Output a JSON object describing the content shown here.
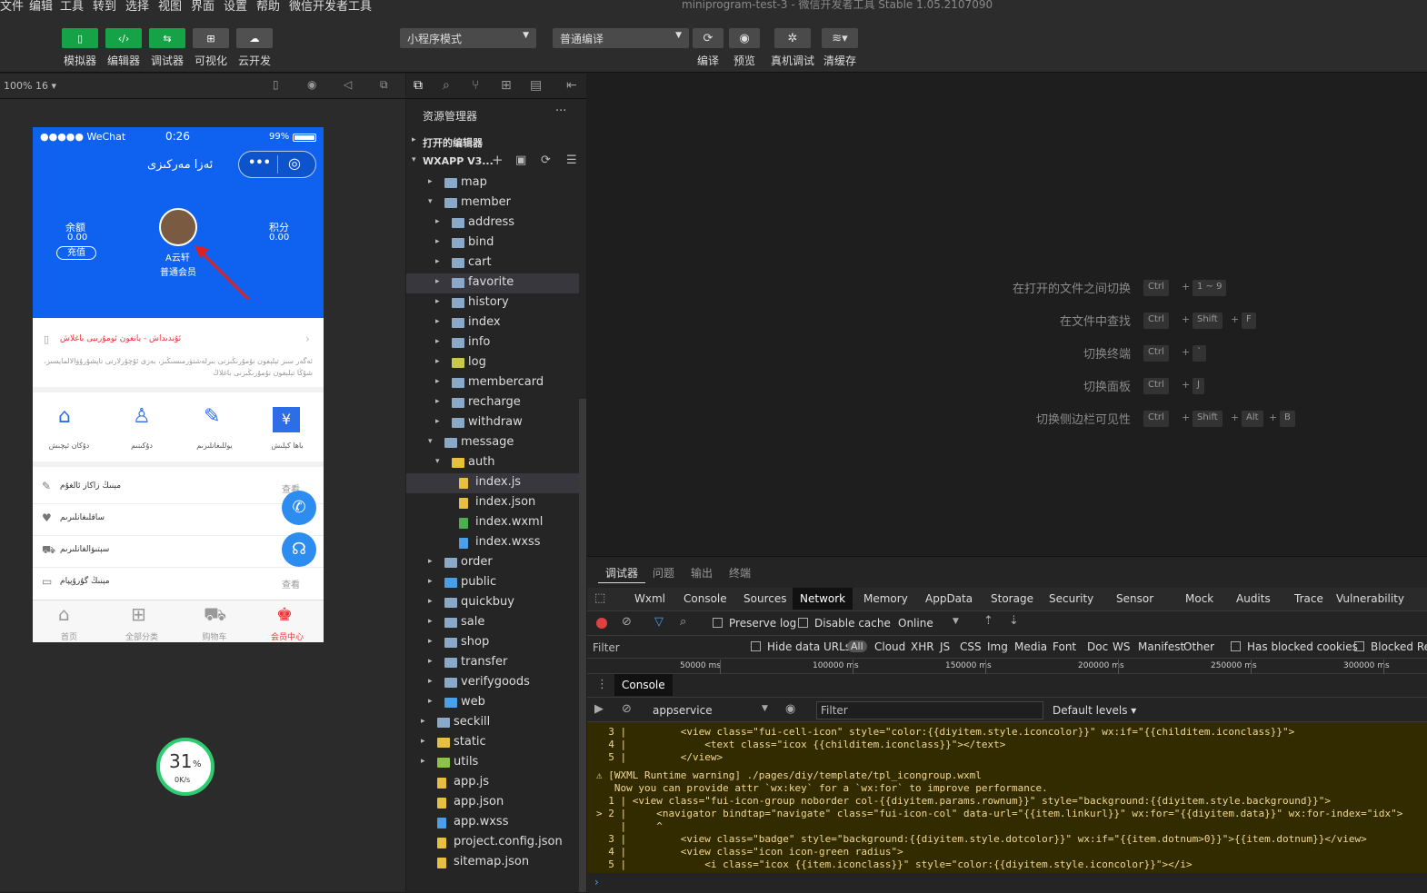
{
  "menu": {
    "items": [
      "文件",
      "编辑",
      "工具",
      "转到",
      "选择",
      "视图",
      "界面",
      "设置",
      "帮助",
      "微信开发者工具"
    ],
    "title": "miniprogram-test-3 - 微信开发者工具 Stable 1.05.2107090"
  },
  "toolbar": {
    "left_buttons": [
      {
        "label": "模拟器",
        "icon": "phone-icon"
      },
      {
        "label": "编辑器",
        "icon": "code-icon"
      },
      {
        "label": "调试器",
        "icon": "debug-icon"
      },
      {
        "label": "可视化",
        "icon": "layout-icon"
      },
      {
        "label": "云开发",
        "icon": "cloud-icon"
      }
    ],
    "mode_select": "小程序模式",
    "compile_select": "普通编译",
    "right_buttons": [
      {
        "label": "编译",
        "icon": "refresh-icon"
      },
      {
        "label": "预览",
        "icon": "eye-icon"
      },
      {
        "label": "真机调试",
        "icon": "bug-icon"
      },
      {
        "label": "清缓存",
        "icon": "layers-icon"
      }
    ]
  },
  "simulator": {
    "zoom": "100% 16 ▾",
    "status": {
      "signal": "●●●●● WeChat",
      "time": "0:26",
      "battery": "99%"
    },
    "nav_title": "ئەزا مەركىزى",
    "balance_label": "余额",
    "balance_value": "0.00",
    "recharge": "充值",
    "points_label": "积分",
    "points_value": "0.00",
    "user_name": "A云轩",
    "user_level": "普通会员",
    "notice_title": "ئۇندىداش - يانغون ئومۇرىيى باغلاش",
    "notice_text": "ئەگەر سىز تېلېفون نۇمۇرىڭىزنى بىرلەشتۈرمىسىڭىز، بەزى ئۇچۇرلارنى تاپشۇرۇۋالالمايسىز، شۇڭا تېلېفون نۇمۇرىڭىزنى باغلاڭ",
    "grid": [
      {
        "label": "دۇكان ئېچىش",
        "icon": "shop-icon"
      },
      {
        "label": "دۇكىنىم",
        "icon": "user-icon"
      },
      {
        "label": "يوللىغانلىرىم",
        "icon": "clipboard-icon"
      },
      {
        "label": "باھا كېلىش",
        "icon": "ticket-icon"
      }
    ],
    "list": [
      {
        "label": "مېنىڭ زاكاز ئالغۇم",
        "icon": "edit-icon",
        "right": "查看"
      },
      {
        "label": "ساقلىغانلىرىم",
        "icon": "heart-icon",
        "right": ""
      },
      {
        "label": "سېتىۋالغانلىرىم",
        "icon": "cart-icon",
        "right": ""
      },
      {
        "label": "مېنىڭ گۇرۇپپام",
        "icon": "card-icon",
        "right": "查看"
      }
    ],
    "tabbar": [
      {
        "label": "首页",
        "icon": "home-icon"
      },
      {
        "label": "全部分类",
        "icon": "grid-icon"
      },
      {
        "label": "购物车",
        "icon": "cart-icon"
      },
      {
        "label": "会员中心",
        "icon": "member-icon"
      }
    ],
    "speed": {
      "percent": "31",
      "unit": "%",
      "rate": "0K/s"
    }
  },
  "explorer": {
    "title": "资源管理器",
    "open_editors": "打开的编辑器",
    "project": "WXAPP V3...",
    "tree": [
      {
        "label": "map",
        "depth": 1,
        "type": "folder",
        "arrow": "▸"
      },
      {
        "label": "member",
        "depth": 1,
        "type": "folder-open",
        "arrow": "▾"
      },
      {
        "label": "address",
        "depth": 2,
        "type": "folder",
        "arrow": "▸"
      },
      {
        "label": "bind",
        "depth": 2,
        "type": "folder",
        "arrow": "▸"
      },
      {
        "label": "cart",
        "depth": 2,
        "type": "folder",
        "arrow": "▸"
      },
      {
        "label": "favorite",
        "depth": 2,
        "type": "folder",
        "arrow": "▸",
        "selected": true
      },
      {
        "label": "history",
        "depth": 2,
        "type": "folder",
        "arrow": "▸"
      },
      {
        "label": "index",
        "depth": 2,
        "type": "folder",
        "arrow": "▸"
      },
      {
        "label": "info",
        "depth": 2,
        "type": "folder",
        "arrow": "▸"
      },
      {
        "label": "log",
        "depth": 2,
        "type": "folder-log",
        "arrow": "▸"
      },
      {
        "label": "membercard",
        "depth": 2,
        "type": "folder",
        "arrow": "▸"
      },
      {
        "label": "recharge",
        "depth": 2,
        "type": "folder",
        "arrow": "▸"
      },
      {
        "label": "withdraw",
        "depth": 2,
        "type": "folder",
        "arrow": "▸"
      },
      {
        "label": "message",
        "depth": 1,
        "type": "folder-open",
        "arrow": "▾"
      },
      {
        "label": "auth",
        "depth": 2,
        "type": "folder-yellow",
        "arrow": "▾"
      },
      {
        "label": "index.js",
        "depth": 3,
        "type": "js",
        "arrow": "",
        "selected": true
      },
      {
        "label": "index.json",
        "depth": 3,
        "type": "json",
        "arrow": ""
      },
      {
        "label": "index.wxml",
        "depth": 3,
        "type": "wxml",
        "arrow": ""
      },
      {
        "label": "index.wxss",
        "depth": 3,
        "type": "wxss",
        "arrow": ""
      },
      {
        "label": "order",
        "depth": 1,
        "type": "folder",
        "arrow": "▸"
      },
      {
        "label": "public",
        "depth": 1,
        "type": "folder-blue",
        "arrow": "▸"
      },
      {
        "label": "quickbuy",
        "depth": 1,
        "type": "folder",
        "arrow": "▸"
      },
      {
        "label": "sale",
        "depth": 1,
        "type": "folder",
        "arrow": "▸"
      },
      {
        "label": "shop",
        "depth": 1,
        "type": "folder",
        "arrow": "▸"
      },
      {
        "label": "transfer",
        "depth": 1,
        "type": "folder",
        "arrow": "▸"
      },
      {
        "label": "verifygoods",
        "depth": 1,
        "type": "folder",
        "arrow": "▸"
      },
      {
        "label": "web",
        "depth": 1,
        "type": "folder-blue",
        "arrow": "▸"
      },
      {
        "label": "seckill",
        "depth": 0,
        "type": "folder",
        "arrow": "▸"
      },
      {
        "label": "static",
        "depth": 0,
        "type": "folder-yellow",
        "arrow": "▸"
      },
      {
        "label": "utils",
        "depth": 0,
        "type": "folder-green",
        "arrow": "▸"
      },
      {
        "label": "app.js",
        "depth": 0,
        "type": "js",
        "arrow": ""
      },
      {
        "label": "app.json",
        "depth": 0,
        "type": "json",
        "arrow": ""
      },
      {
        "label": "app.wxss",
        "depth": 0,
        "type": "wxss",
        "arrow": ""
      },
      {
        "label": "project.config.json",
        "depth": 0,
        "type": "json",
        "arrow": ""
      },
      {
        "label": "sitemap.json",
        "depth": 0,
        "type": "json",
        "arrow": ""
      }
    ]
  },
  "editor": {
    "hints": [
      {
        "label": "在打开的文件之间切换",
        "keys": [
          "Ctrl",
          "1 ~ 9"
        ]
      },
      {
        "label": "在文件中查找",
        "keys": [
          "Ctrl",
          "Shift",
          "F"
        ]
      },
      {
        "label": "切换终端",
        "keys": [
          "Ctrl",
          "`"
        ]
      },
      {
        "label": "切换面板",
        "keys": [
          "Ctrl",
          "J"
        ]
      },
      {
        "label": "切换侧边栏可见性",
        "keys": [
          "Ctrl",
          "Shift",
          "Alt",
          "B"
        ]
      }
    ]
  },
  "devtools": {
    "top_tabs": [
      "调试器",
      "问题",
      "输出",
      "终端"
    ],
    "tabs": [
      "Wxml",
      "Console",
      "Sources",
      "Network",
      "Memory",
      "AppData",
      "Storage",
      "Security",
      "Sensor",
      "Mock",
      "Audits",
      "Trace",
      "Vulnerability"
    ],
    "active_tab": "Network",
    "net": {
      "preserve": "Preserve log",
      "disable": "Disable cache",
      "online": "Online"
    },
    "filter": {
      "placeholder": "Filter",
      "hide": "Hide data URLs",
      "types": [
        "All",
        "Cloud",
        "XHR",
        "JS",
        "CSS",
        "Img",
        "Media",
        "Font",
        "Doc",
        "WS",
        "Manifest",
        "Other"
      ],
      "blocked": "Has blocked cookies",
      "blocked_req": "Blocked Requests"
    },
    "timeline": [
      "50000 ms",
      "100000 ms",
      "150000 ms",
      "200000 ms",
      "250000 ms",
      "300000 ms"
    ],
    "console_tab": "Console",
    "console_context": "appservice",
    "console_filter": "Filter",
    "levels": "Default levels ▾",
    "lines": [
      "  3 |         <view class=\"fui-cell-icon\" style=\"color:{{diyitem.style.iconcolor}}\" wx:if=\"{{childitem.iconclass}}\">",
      "  4 |             <text class=\"icox {{childitem.iconclass}}\"></text>",
      "  5 |         </view>",
      "⚠ [WXML Runtime warning] ./pages/diy/template/tpl_icongroup.wxml",
      "   Now you can provide attr `wx:key` for a `wx:for` to improve performance.",
      "  1 | <view class=\"fui-icon-group noborder col-{{diyitem.params.rownum}}\" style=\"background:{{diyitem.style.background}}\">",
      "> 2 |     <navigator bindtap=\"navigate\" class=\"fui-icon-col\" data-url=\"{{item.linkurl}}\" wx:for=\"{{diyitem.data}}\" wx:for-index=\"idx\">",
      "    |     ^",
      "  3 |         <view class=\"badge\" style=\"background:{{diyitem.style.dotcolor}}\" wx:if=\"{{item.dotnum>0}}\">{{item.dotnum}}</view>",
      "  4 |         <view class=\"icon icon-green radius\">",
      "  5 |             <i class=\"icox {{item.iconclass}}\" style=\"color:{{diyitem.style.iconcolor}}\"></i>"
    ]
  }
}
